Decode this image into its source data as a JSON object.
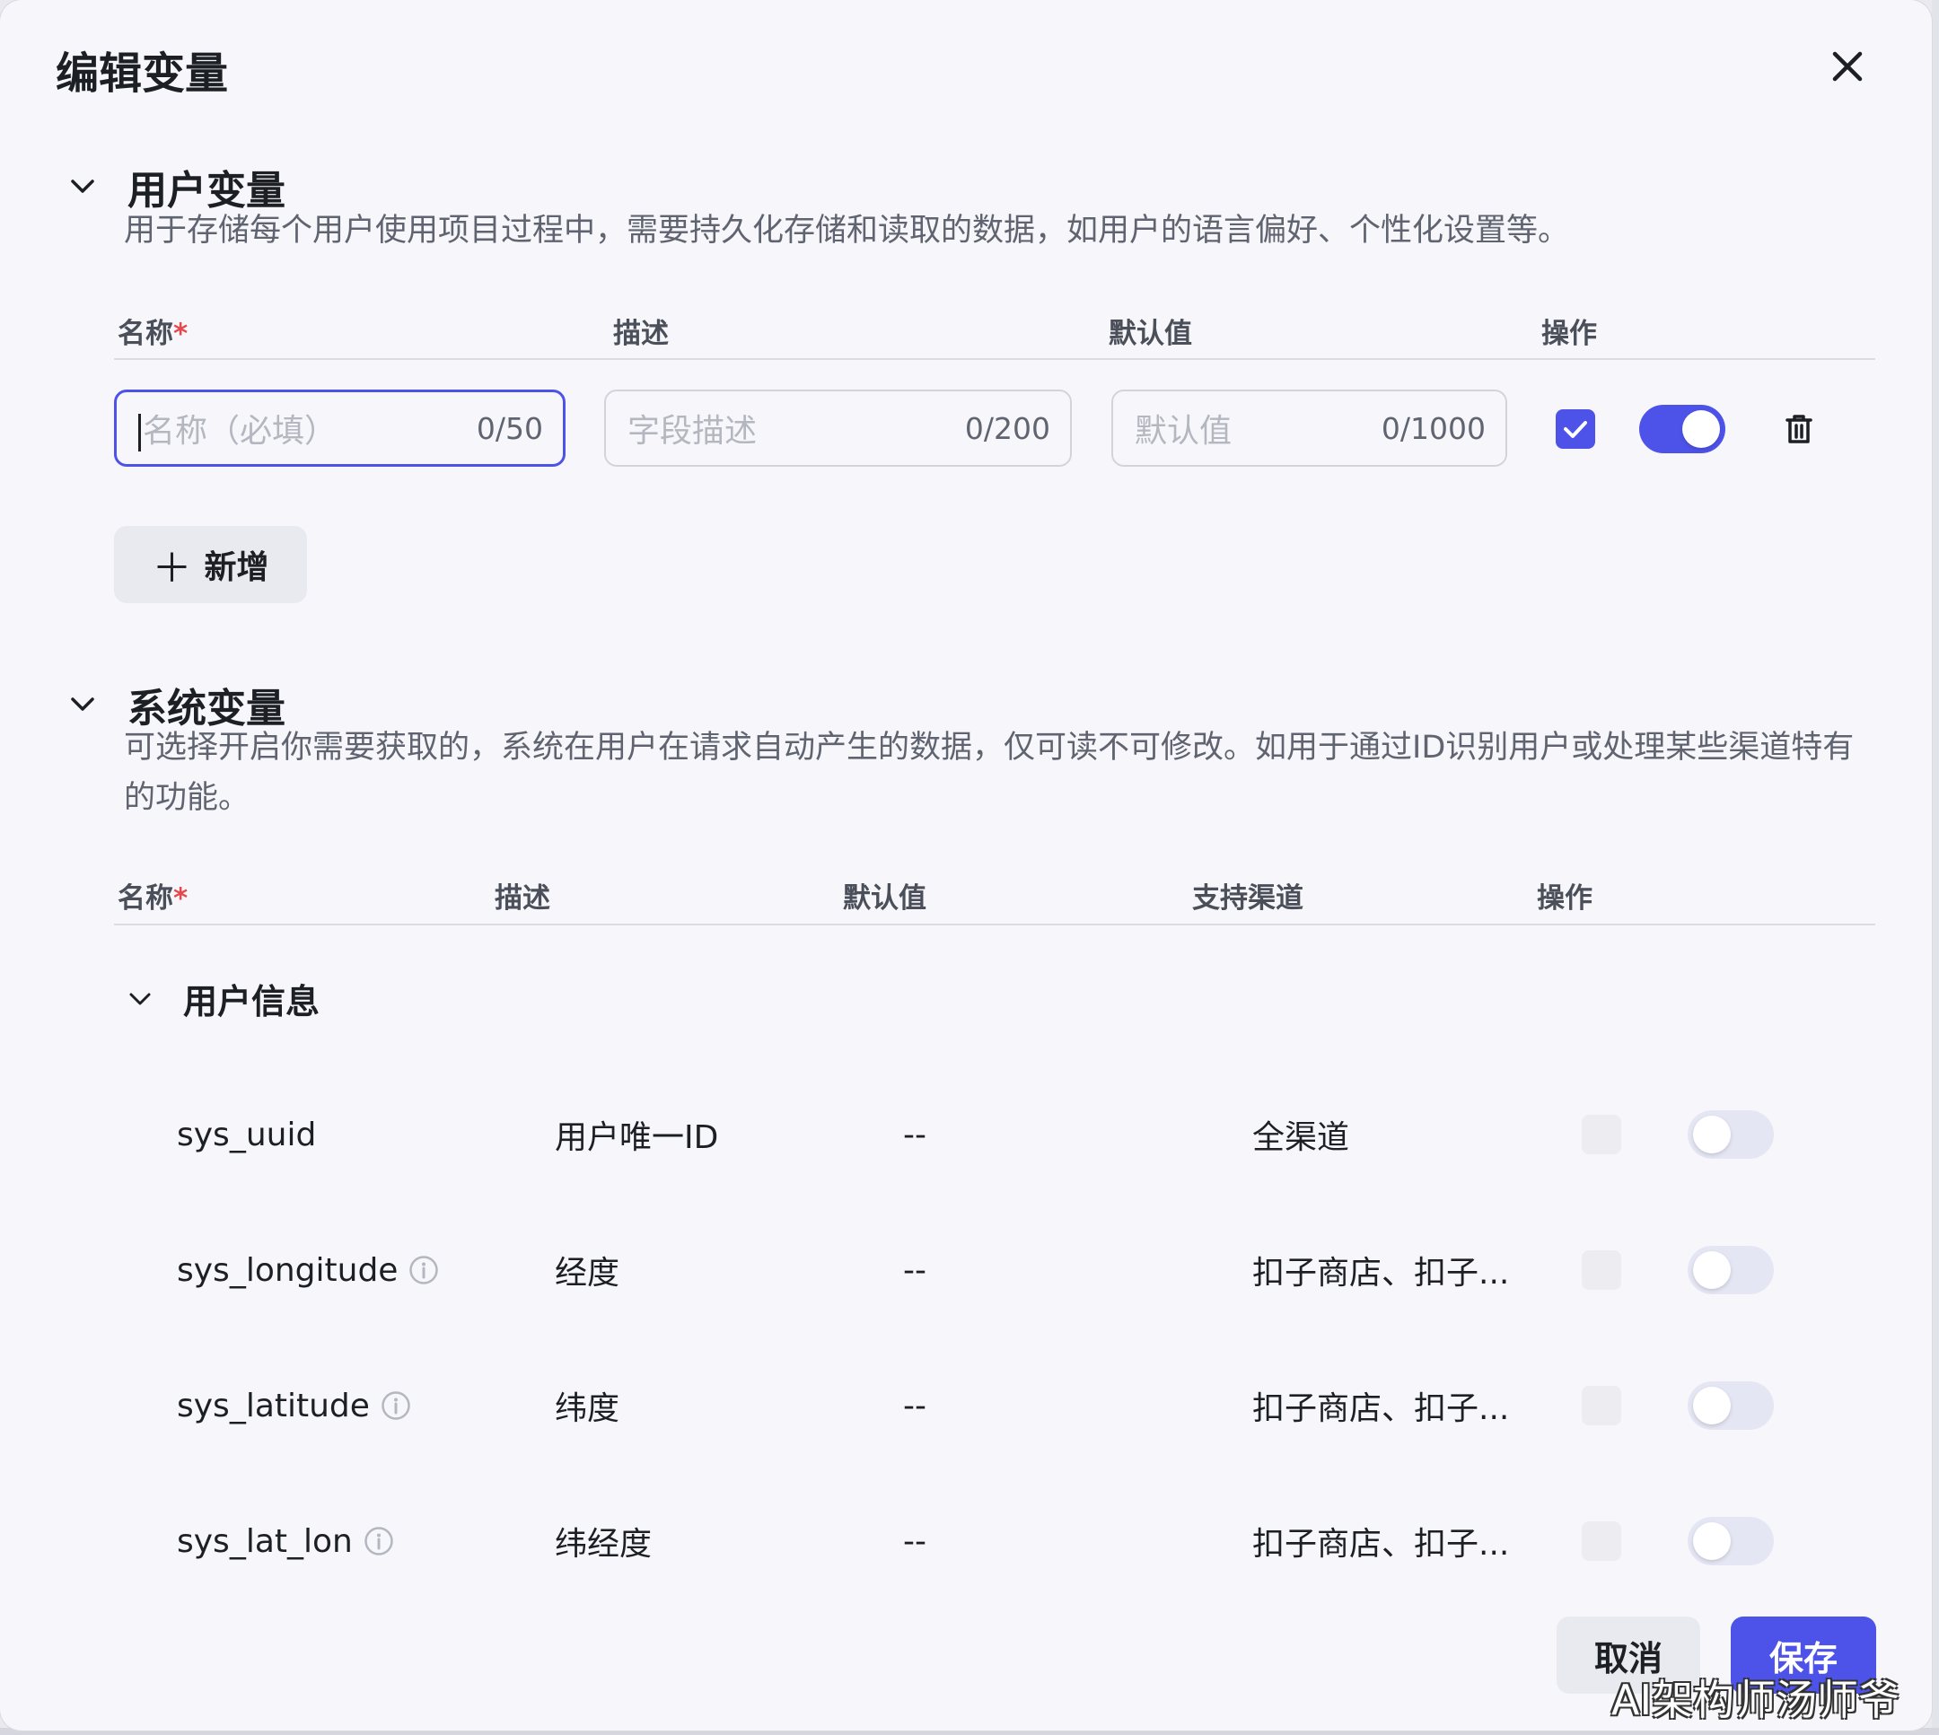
{
  "dialog": {
    "title": "编辑变量",
    "close_icon": "close-icon"
  },
  "user_vars": {
    "title": "用户变量",
    "description": "用于存储每个用户使用项目过程中，需要持久化存储和读取的数据，如用户的语言偏好、个性化设置等。",
    "columns": {
      "name": "名称",
      "required_mark": "*",
      "desc": "描述",
      "default": "默认值",
      "ops": "操作"
    },
    "row": {
      "name_placeholder": "名称（必填）",
      "name_count": "0/50",
      "desc_placeholder": "字段描述",
      "desc_count": "0/200",
      "default_placeholder": "默认值",
      "default_count": "0/1000",
      "checked": true,
      "enabled": true
    },
    "add_label": "新增",
    "add_icon": "plus-icon"
  },
  "sys_vars": {
    "title": "系统变量",
    "description": "可选择开启你需要获取的，系统在用户在请求自动产生的数据，仅可读不可修改。如用于通过ID识别用户或处理某些渠道特有的功能。",
    "columns": {
      "name": "名称",
      "required_mark": "*",
      "desc": "描述",
      "default": "默认值",
      "channels": "支持渠道",
      "ops": "操作"
    },
    "group": {
      "title": "用户信息",
      "rows": [
        {
          "name": "sys_uuid",
          "info": false,
          "desc": "用户唯一ID",
          "default": "--",
          "channels": "全渠道",
          "enabled": false
        },
        {
          "name": "sys_longitude",
          "info": true,
          "desc": "经度",
          "default": "--",
          "channels": "扣子商店、扣子...",
          "enabled": false
        },
        {
          "name": "sys_latitude",
          "info": true,
          "desc": "纬度",
          "default": "--",
          "channels": "扣子商店、扣子...",
          "enabled": false
        },
        {
          "name": "sys_lat_lon",
          "info": true,
          "desc": "纬经度",
          "default": "--",
          "channels": "扣子商店、扣子...",
          "enabled": false
        }
      ]
    }
  },
  "footer": {
    "cancel_label": "取消",
    "save_label": "保存"
  },
  "watermark": "AI架构师汤师爷",
  "colors": {
    "accent": "#4d53e8",
    "required": "#e5484d",
    "background": "#f7f7fb"
  }
}
